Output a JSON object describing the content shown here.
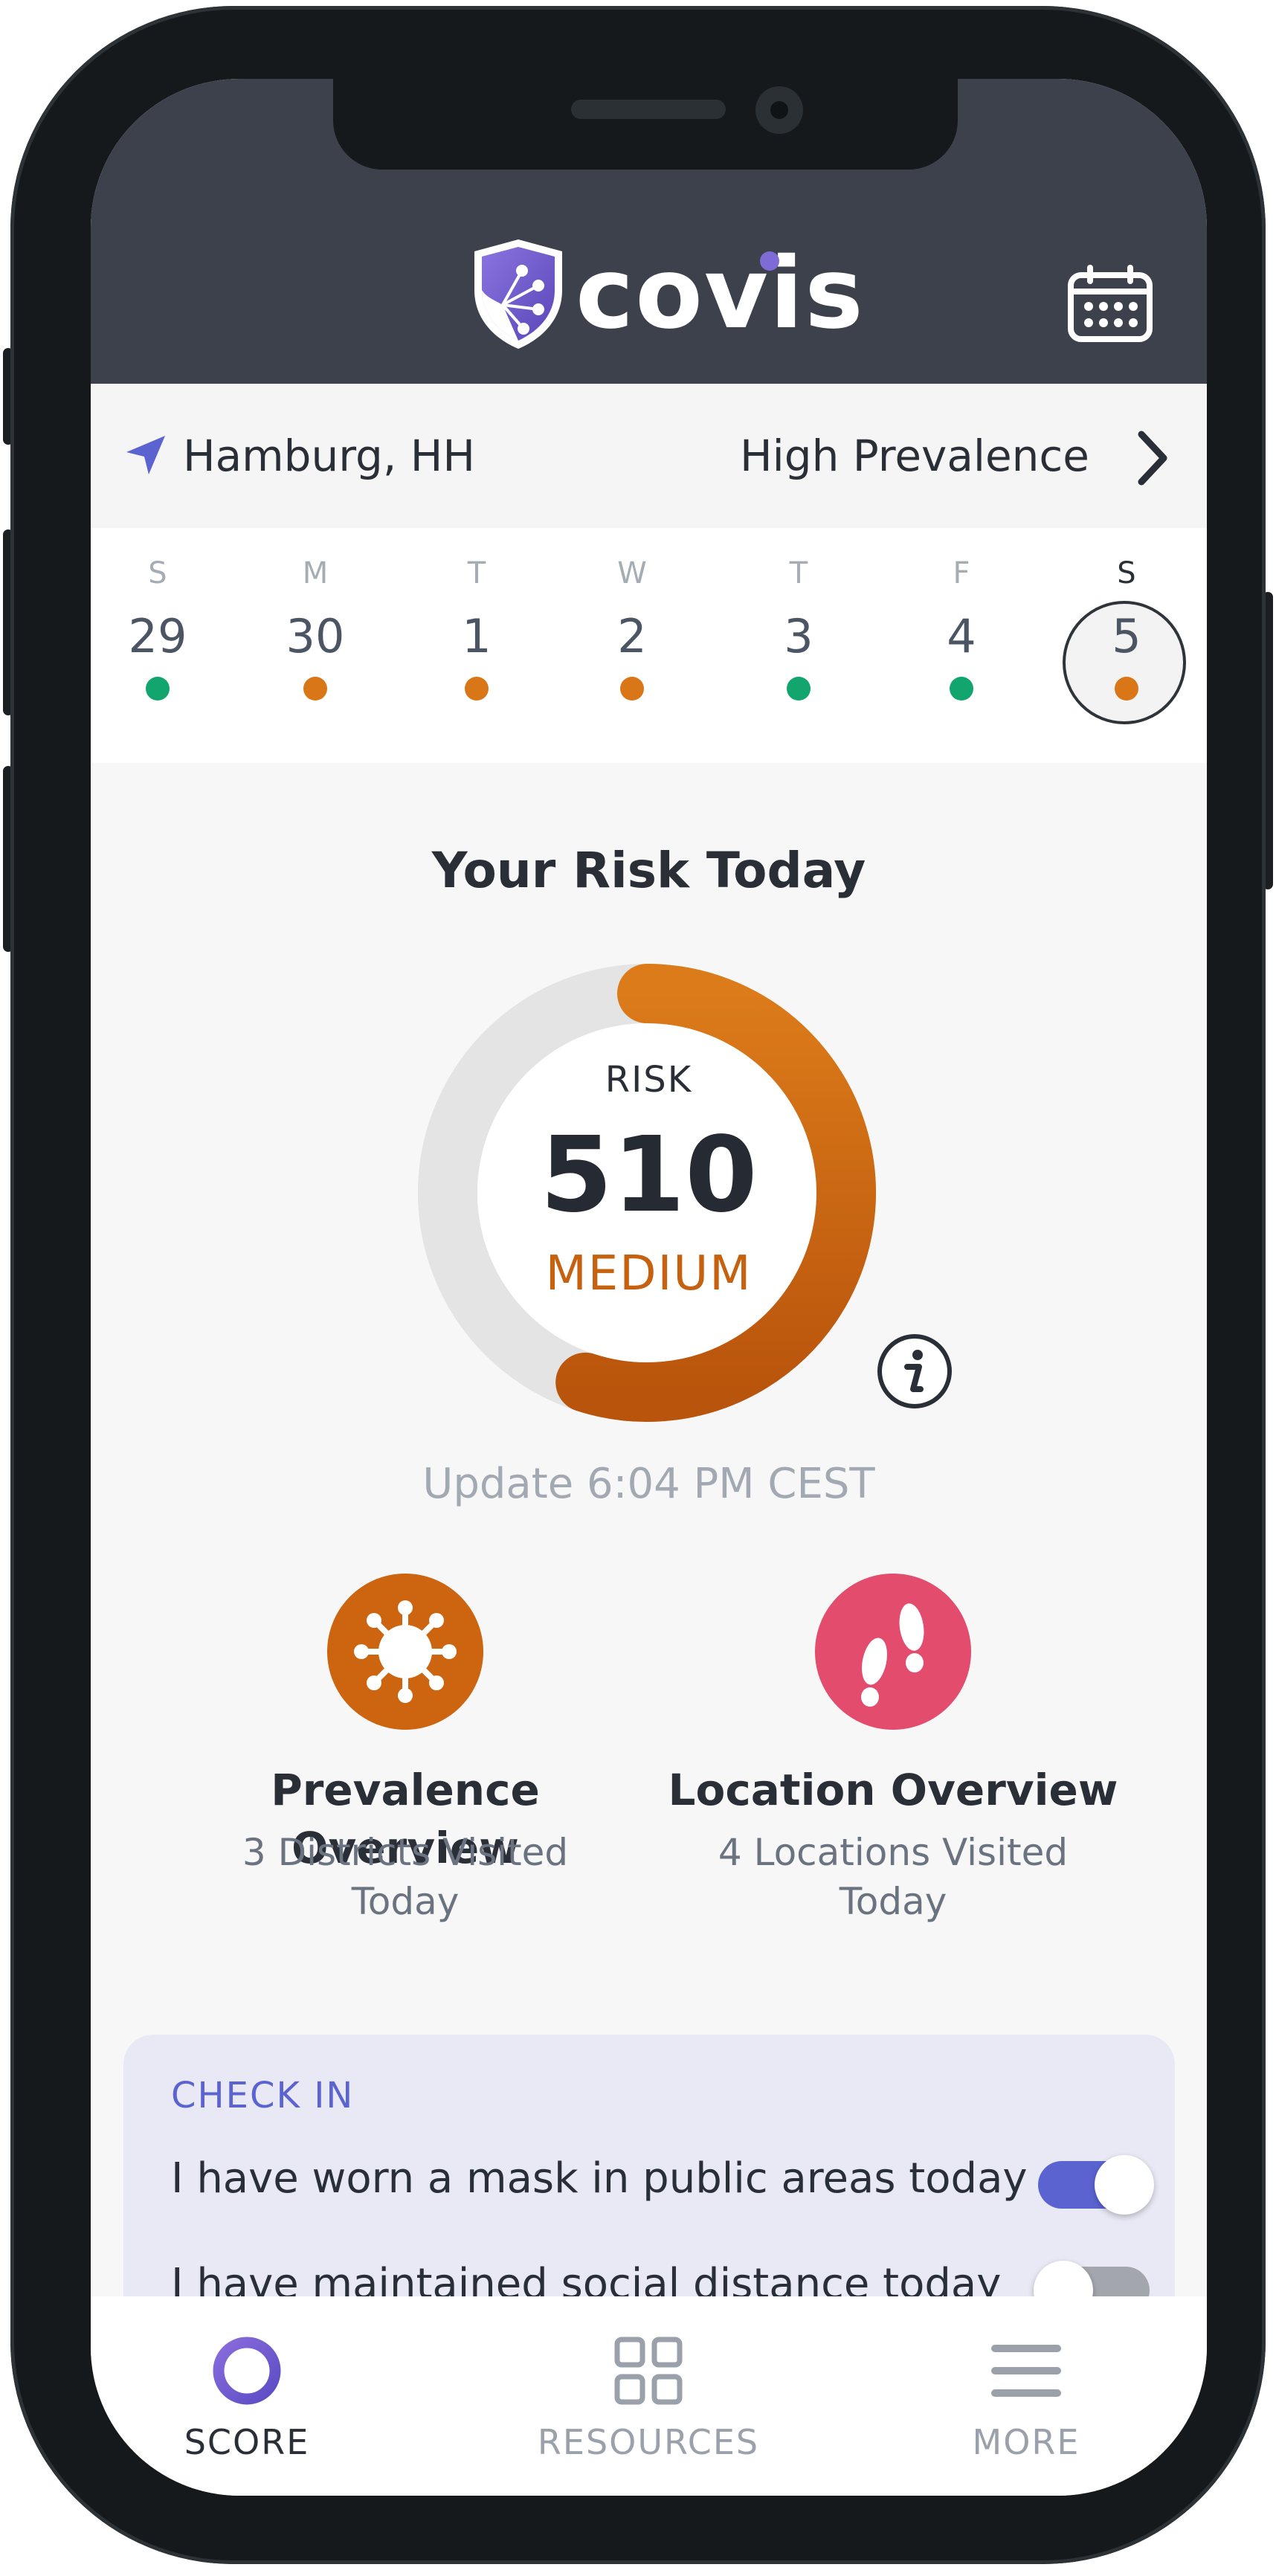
{
  "app": {
    "brand": "covis"
  },
  "header": {
    "calendar_icon": "calendar-icon",
    "shield_icon": "covis-shield-logo"
  },
  "location_bar": {
    "city": "Hamburg, HH",
    "prevalence": "High Prevalence",
    "arrow_icon": "location-arrow-icon",
    "chevron_icon": "chevron-right-icon"
  },
  "week": {
    "days": [
      {
        "dow": "S",
        "date": "29",
        "status": "low",
        "color": "#12a56d"
      },
      {
        "dow": "M",
        "date": "30",
        "status": "medium",
        "color": "#d97718"
      },
      {
        "dow": "T",
        "date": "1",
        "status": "medium",
        "color": "#d97718"
      },
      {
        "dow": "W",
        "date": "2",
        "status": "medium",
        "color": "#d97718"
      },
      {
        "dow": "T",
        "date": "3",
        "status": "low",
        "color": "#12a56d"
      },
      {
        "dow": "F",
        "date": "4",
        "status": "low",
        "color": "#12a56d"
      },
      {
        "dow": "S",
        "date": "5",
        "status": "medium",
        "color": "#d97718",
        "selected": true
      }
    ]
  },
  "risk": {
    "title": "Your Risk Today",
    "label": "RISK",
    "score": "510",
    "level": "MEDIUM",
    "gauge_fraction": 0.55,
    "gauge_color": "#d97718",
    "update": "Update 6:04 PM CEST",
    "info_icon": "info-icon"
  },
  "overviews": [
    {
      "title": "Prevalence Overview",
      "subtitle": "3 Districts Visited Today",
      "icon": "virus-icon",
      "color": "#cc6410"
    },
    {
      "title": "Location Overview",
      "subtitle": "4 Locations Visited Today",
      "icon": "footprints-icon",
      "color": "#e34c6d"
    }
  ],
  "checkin": {
    "title": "CHECK IN",
    "items": [
      {
        "text": "I have worn a mask in public areas today",
        "checked": true
      },
      {
        "text": "I have maintained social distance today",
        "checked": false
      }
    ]
  },
  "tabbar": {
    "tabs": [
      {
        "label": "SCORE",
        "icon": "score-ring-icon",
        "active": true
      },
      {
        "label": "RESOURCES",
        "icon": "grid-icon",
        "active": false
      },
      {
        "label": "MORE",
        "icon": "menu-icon",
        "active": false
      }
    ]
  },
  "colors": {
    "header_bg": "#3d414c",
    "accent": "#5b63d0",
    "medium": "#d97718",
    "low": "#12a56d"
  }
}
